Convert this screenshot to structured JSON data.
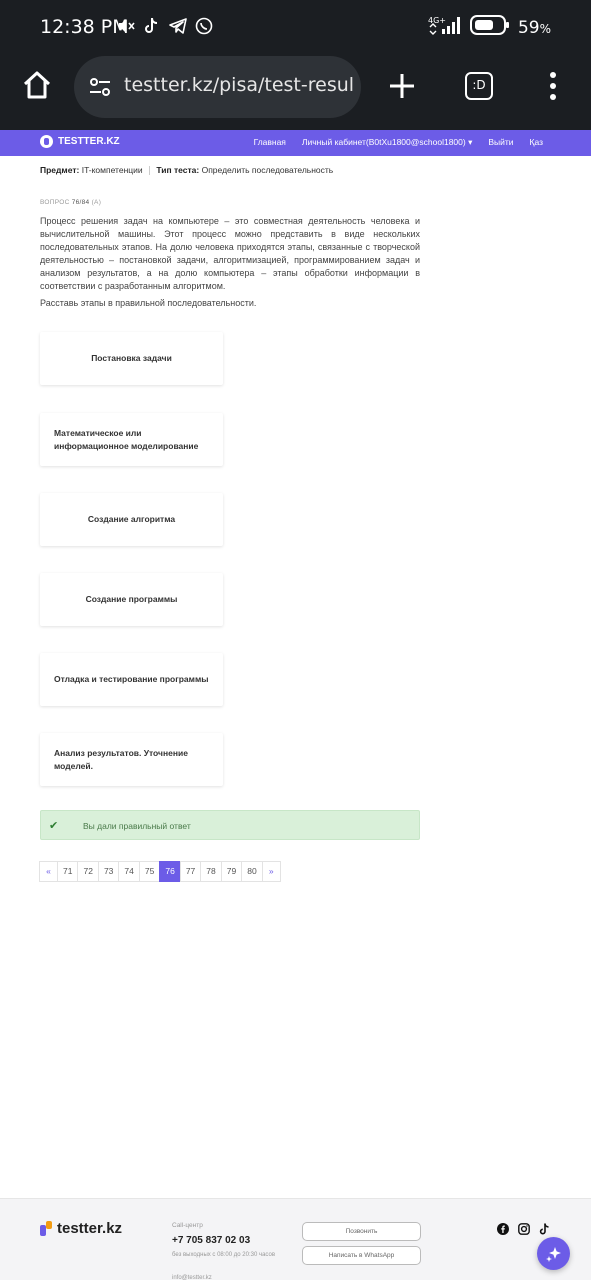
{
  "status_bar": {
    "time": "12:38 PM",
    "battery": "59",
    "battery_unit": "%",
    "network": "4G+",
    "icons": [
      "mute-icon",
      "tiktok-icon",
      "telegram-icon",
      "whatsapp-icon",
      "signal-icon",
      "battery-icon"
    ]
  },
  "browser": {
    "url": "testter.kz/pisa/test-result/s",
    "tabs_label": ":D"
  },
  "nav": {
    "brand": "TESTTER.KZ",
    "links": [
      "Главная",
      "Личный кабинет(B0tXu1800@school1800) ▾",
      "Выйти",
      "Қаз"
    ]
  },
  "meta": {
    "subject_label": "Предмет:",
    "subject_value": "IT-компетенции",
    "type_label": "Тип теста:",
    "type_value": "Определить последовательность"
  },
  "question": {
    "label": "ВОПРОС",
    "number": "76/84",
    "extra": "(A)",
    "text": "Процесс решения задач на компьютере – это совместная деятельность человека и вычислительной машины. Этот процесс можно представить в виде нескольких последовательных этапов. На долю человека приходятся этапы, связанные с творческой деятельностью – постановкой задачи, алгоритмизацией, программированием задач и анализом результатов, а на долю компьютера – этапы обработки информации в соответствии с разработанным алгоритмом.",
    "prompt": "Расставь этапы в правильной последовательности."
  },
  "cards": [
    "Постановка задачи",
    "Математическое или информационное моделирование",
    "Создание алгоритма",
    "Создание программы",
    "Отладка и тестирование программы",
    "Анализ результатов. Уточнение моделей."
  ],
  "answer": {
    "text": "Вы дали правильный ответ"
  },
  "pager": {
    "prev": "«",
    "pages": [
      "71",
      "72",
      "73",
      "74",
      "75",
      "76",
      "77",
      "78",
      "79",
      "80"
    ],
    "active": "76",
    "next": "»"
  },
  "footer": {
    "brand": "testter.kz",
    "call_label": "Call-центр",
    "phone": "+7 705 837 02 03",
    "hours": "без выходных с 08:00 до 20:30 часов",
    "email": "info@testter.kz",
    "call_button": "Позвонить",
    "whatsapp_button": "Написать в WhatsApp",
    "social": [
      "facebook-icon",
      "instagram-icon",
      "tiktok-icon"
    ]
  },
  "colors": {
    "accent": "#6c5ce7",
    "success_bg": "#d9f0d9",
    "status_bar": "#1b1e22"
  }
}
